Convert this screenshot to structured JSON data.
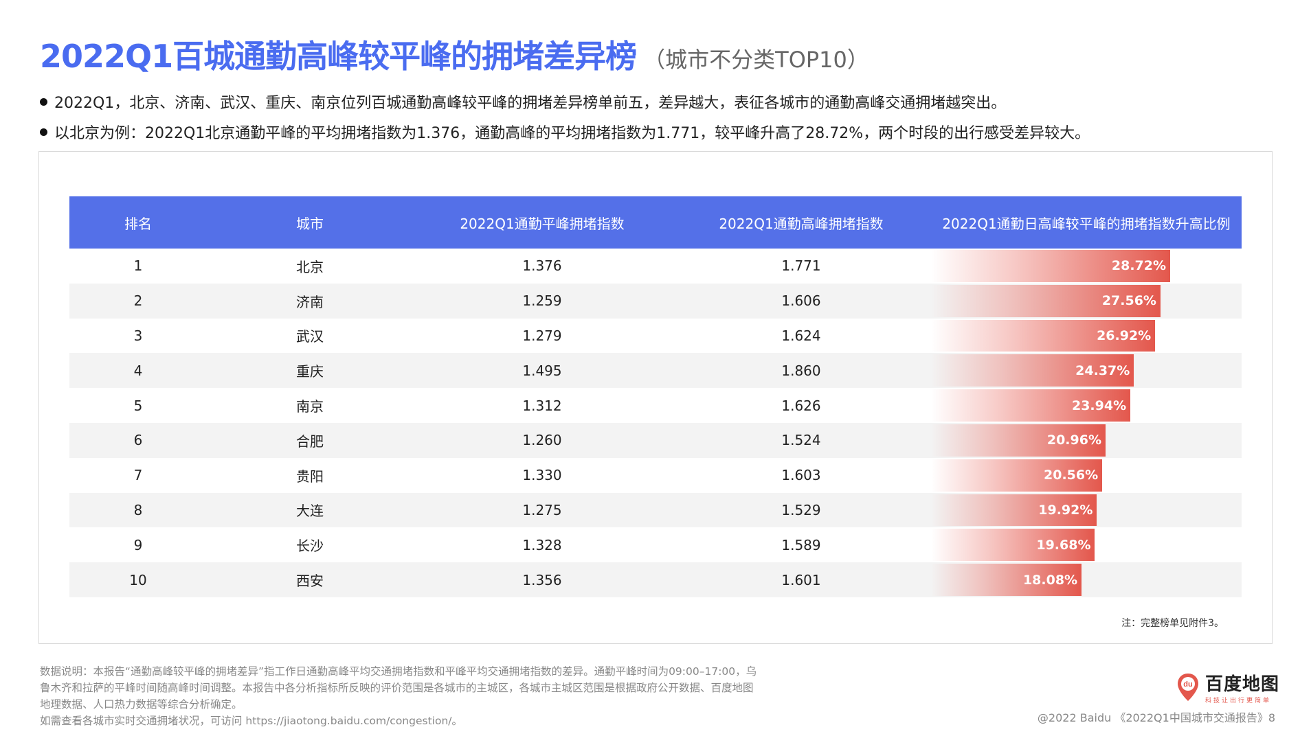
{
  "header": {
    "title": "2022Q1百城通勤高峰较平峰的拥堵差异榜",
    "subtitle": "（城市不分类TOP10）"
  },
  "bullets": [
    "2022Q1，北京、济南、武汉、重庆、南京位列百城通勤高峰较平峰的拥堵差异榜单前五，差异越大，表征各城市的通勤高峰交通拥堵越突出。",
    "以北京为例：2022Q1北京通勤平峰的平均拥堵指数为1.376，通勤高峰的平均拥堵指数为1.771，较平峰升高了28.72%，两个时段的出行感受差异较大。"
  ],
  "table": {
    "headers": [
      "排名",
      "城市",
      "2022Q1通勤平峰拥堵指数",
      "2022Q1通勤高峰拥堵指数",
      "2022Q1通勤日高峰较平峰的拥堵指数升高比例"
    ],
    "rows": [
      {
        "rank": "1",
        "city": "北京",
        "offpeak": "1.376",
        "peak": "1.771",
        "ratio": "28.72%",
        "ratio_value": 28.72
      },
      {
        "rank": "2",
        "city": "济南",
        "offpeak": "1.259",
        "peak": "1.606",
        "ratio": "27.56%",
        "ratio_value": 27.56
      },
      {
        "rank": "3",
        "city": "武汉",
        "offpeak": "1.279",
        "peak": "1.624",
        "ratio": "26.92%",
        "ratio_value": 26.92
      },
      {
        "rank": "4",
        "city": "重庆",
        "offpeak": "1.495",
        "peak": "1.860",
        "ratio": "24.37%",
        "ratio_value": 24.37
      },
      {
        "rank": "5",
        "city": "南京",
        "offpeak": "1.312",
        "peak": "1.626",
        "ratio": "23.94%",
        "ratio_value": 23.94
      },
      {
        "rank": "6",
        "city": "合肥",
        "offpeak": "1.260",
        "peak": "1.524",
        "ratio": "20.96%",
        "ratio_value": 20.96
      },
      {
        "rank": "7",
        "city": "贵阳",
        "offpeak": "1.330",
        "peak": "1.603",
        "ratio": "20.56%",
        "ratio_value": 20.56
      },
      {
        "rank": "8",
        "city": "大连",
        "offpeak": "1.275",
        "peak": "1.529",
        "ratio": "19.92%",
        "ratio_value": 19.92
      },
      {
        "rank": "9",
        "city": "长沙",
        "offpeak": "1.328",
        "peak": "1.589",
        "ratio": "19.68%",
        "ratio_value": 19.68
      },
      {
        "rank": "10",
        "city": "西安",
        "offpeak": "1.356",
        "peak": "1.601",
        "ratio": "18.08%",
        "ratio_value": 18.08
      }
    ],
    "note": "注：完整榜单见附件3。"
  },
  "footer": {
    "notes": [
      "数据说明：本报告“通勤高峰较平峰的拥堵差异”指工作日通勤高峰平均交通拥堵指数和平峰平均交通拥堵指数的差异。通勤平峰时间为09:00–17:00，乌",
      "鲁木齐和拉萨的平峰时间随高峰时间调整。本报告中各分析指标所反映的评价范围是各城市的主城区，各城市主城区范围是根据政府公开数据、百度地图",
      "地理数据、人口热力数据等综合分析确定。",
      "如需查看各城市实时交通拥堵状况，可访问 https://jiaotong.baidu.com/congestion/。"
    ],
    "logo_name": "百度地图",
    "logo_slogan": "科技让出行更简单",
    "logo_badge": "du",
    "copyright": "@2022 Baidu 《2022Q1中国城市交通报告》8"
  },
  "colors": {
    "title": "#4a6cf0",
    "header_bg": "#5470e8",
    "bar": "#e3574c"
  }
}
